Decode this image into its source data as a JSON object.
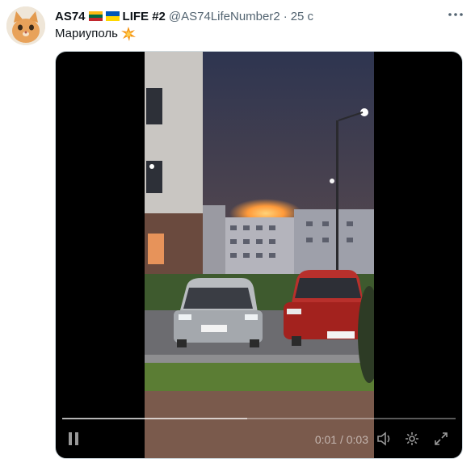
{
  "tweet": {
    "author_name_prefix": "AS74",
    "author_name_suffix": "LIFE #2",
    "handle": "@AS74LifeNumber2",
    "separator": "·",
    "time": "25 с",
    "text": "Мариуполь",
    "icons": {
      "avatar": "cat-avatar",
      "flag_1": "lithuania-flag-icon",
      "flag_2": "ukraine-flag-icon",
      "emoji": "collision-icon",
      "more": "more-icon"
    }
  },
  "video": {
    "current_time": "0:01",
    "time_separator": "/",
    "duration": "0:03",
    "progress_fraction": 0.47,
    "controls": [
      "pause-icon",
      "volume-icon",
      "settings-icon",
      "fullscreen-icon"
    ]
  }
}
